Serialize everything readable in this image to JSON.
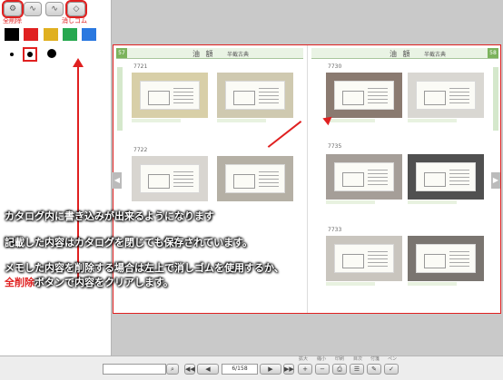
{
  "toolbar": {
    "tools": [
      {
        "icon": "gear-icon",
        "glyph": "⚙"
      },
      {
        "icon": "pen-stroke-icon",
        "glyph": "∿"
      },
      {
        "icon": "pen-stroke-light-icon",
        "glyph": "∿"
      },
      {
        "icon": "eraser-icon",
        "glyph": "◇"
      }
    ],
    "clear_all_label": "全削除",
    "eraser_label": "消しゴム"
  },
  "colors": {
    "swatches": [
      "#000000",
      "#e02020",
      "#e0b020",
      "#27a850",
      "#2a78e0"
    ],
    "accent": "#e02020"
  },
  "catalog": {
    "left_page_number": "57",
    "right_page_number": "58",
    "left_title": "油 額",
    "left_subtitle": "半截古典",
    "right_title": "油 額",
    "right_subtitle": "半截古典",
    "codes_left": [
      "7721",
      "7722"
    ],
    "codes_right": [
      "7730",
      "7735",
      "7733"
    ],
    "frame_colors_left": [
      "#d8cfa8",
      "#cfc9b0",
      "#d8d5d0",
      "#b5b0a5"
    ],
    "frame_colors_right": [
      "#8a7a70",
      "#d9d7d2",
      "#a59e98",
      "#505050",
      "#c9c5be",
      "#7a7570"
    ]
  },
  "annotations": {
    "line1": "カタログ内に書き込みが出来るようになります",
    "line2": "記載した内容はカタログを閉じても保存されています。",
    "line3": "メモした内容を削除する場合は左上で消しゴムを使用するか、",
    "line4_strong": "全削除",
    "line4_rest": "ボタンで内容をクリアします。"
  },
  "bottom": {
    "search_placeholder": "",
    "page_counter": "6/158",
    "labels": [
      "拡大",
      "縮小",
      "印刷",
      "目次",
      "付箋",
      "ペン"
    ]
  }
}
